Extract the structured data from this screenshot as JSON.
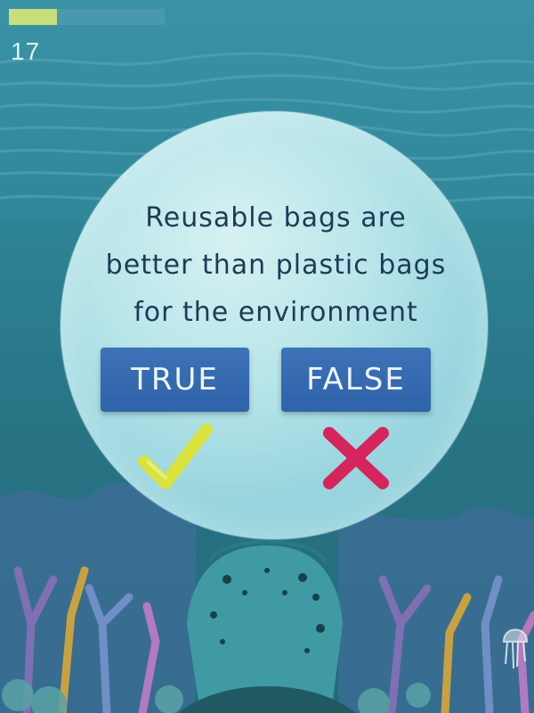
{
  "hud": {
    "progress_fraction": 0.31,
    "score": "17"
  },
  "question": {
    "text": "Reusable bags are\nbetter than plastic bags\nfor the environment"
  },
  "answers": {
    "true_label": "TRUE",
    "false_label": "FALSE"
  },
  "icons": {
    "check": "check-mark-icon",
    "cross": "cross-mark-icon"
  },
  "colors": {
    "progress": "#c7de7a",
    "button": "#3168ad",
    "check": "#dbe23b",
    "cross": "#d6245d",
    "text": "#1d3b57"
  }
}
